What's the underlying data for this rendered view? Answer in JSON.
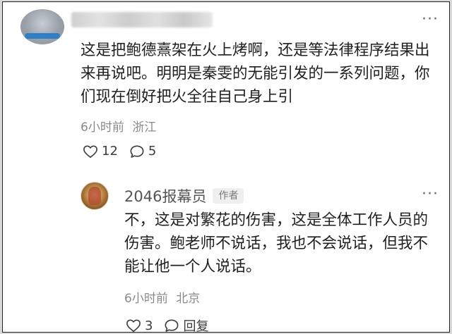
{
  "comment": {
    "text": "这是把鲍德熹架在火上烤啊，还是等法律程序结果出来再说吧。明明是秦雯的无能引发的一系列问题，你们现在倒好把火全往自己身上引",
    "time": "6小时前",
    "location": "浙江",
    "likes": "12",
    "replies": "5",
    "more": "···"
  },
  "reply": {
    "username": "2046报幕员",
    "badge": "作者",
    "text": "不，这是对繁花的伤害，这是全体工作人员的伤害。鲍老师不说话，我也不会说话，但我不能让他一个人说话。",
    "time": "6小时前",
    "location": "北京",
    "likes": "3",
    "reply_label": "回复",
    "more": "···"
  },
  "icons": {
    "like": "heart-outline-icon",
    "comment": "speech-bubble-icon",
    "more": "more-dots-icon"
  },
  "colors": {
    "text": "#1f1f1f",
    "meta": "#8a8a8a",
    "badge_bg": "#efefef"
  }
}
